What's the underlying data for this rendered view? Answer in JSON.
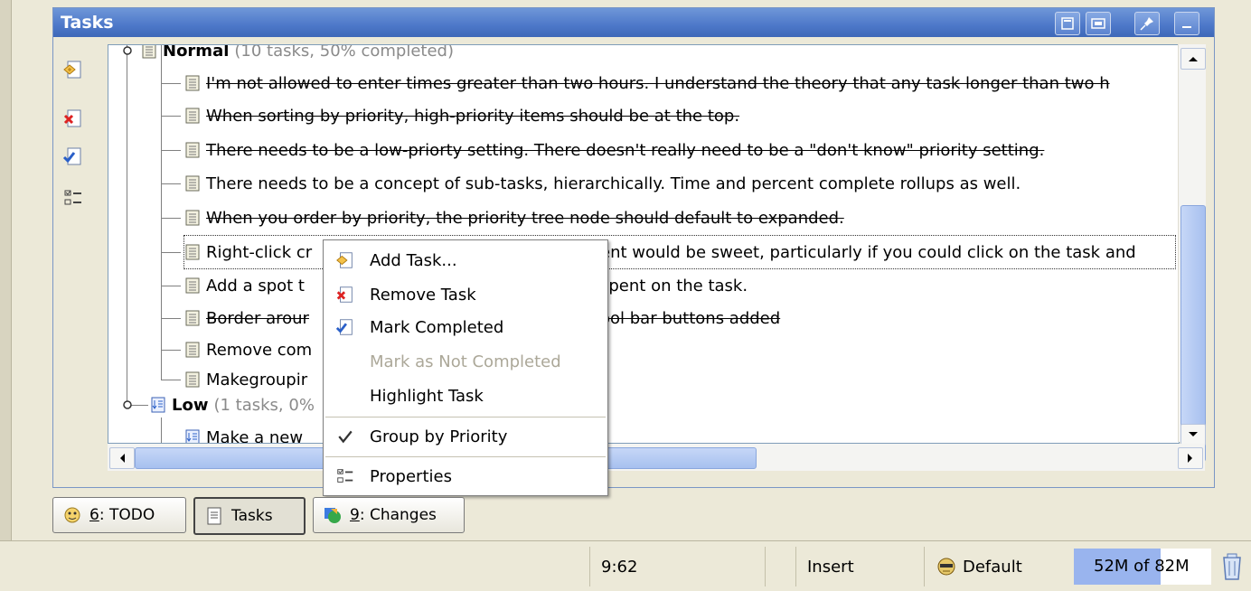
{
  "panel": {
    "title": "Tasks"
  },
  "tree": {
    "groups": [
      {
        "name": "Normal",
        "summary": "(10 tasks, 50% completed)"
      },
      {
        "name": "Low",
        "summary": "(1 tasks, 0%"
      }
    ],
    "tasks": [
      {
        "text": "I'm not allowed to enter times greater than two hours. I understand the theory that any task longer than two h",
        "completed": true
      },
      {
        "text": "When sorting by priority, high-priority items should be at the top.",
        "completed": true
      },
      {
        "text": "There needs to be a low-priorty setting. There doesn't really need to be a \"don't know\" priority setting.",
        "completed": true
      },
      {
        "text": "There needs to be a concept of sub-tasks, hierarchically. Time and percent complete rollups as well.",
        "completed": false
      },
      {
        "text": "When you order by priority, the priority tree node should default to expanded.",
        "completed": true
      },
      {
        "text_left": "Right-click cr",
        "text_right": "ent would be sweet, particularly if you could click on the task and",
        "completed": false,
        "focused": true
      },
      {
        "text_left": "Add a spot t",
        "text_right": "spent on the task.",
        "completed": false
      },
      {
        "text_left": "Border arour",
        "text_right": "ool bar buttons added",
        "completed": true
      },
      {
        "text_left": "Remove com",
        "text_right": "",
        "completed": false
      },
      {
        "text_left": "Makegroupir",
        "text_right": "",
        "completed": false
      }
    ],
    "low_tasks": [
      {
        "text_left": "Make a new",
        "completed": false
      }
    ]
  },
  "context_menu": {
    "items": [
      {
        "label": "Add Task...",
        "icon": "add-task-icon",
        "enabled": true
      },
      {
        "label": "Remove Task",
        "icon": "remove-task-icon",
        "enabled": true
      },
      {
        "label": "Mark Completed",
        "icon": "mark-completed-icon",
        "enabled": true
      },
      {
        "label": "Mark as Not Completed",
        "icon": "",
        "enabled": false
      },
      {
        "label": "Highlight Task",
        "icon": "",
        "enabled": true
      },
      {
        "label": "Group by Priority",
        "icon": "checkmark-icon",
        "enabled": true,
        "checked": true
      },
      {
        "label": "Properties",
        "icon": "properties-icon",
        "enabled": true
      }
    ]
  },
  "bottom_tabs": [
    {
      "mnemonic": "6",
      "label": ": TODO",
      "icon": "todo-icon",
      "active": false
    },
    {
      "mnemonic": "",
      "label": "Tasks",
      "icon": "tasks-icon",
      "active": true
    },
    {
      "mnemonic": "9",
      "label": ": Changes",
      "icon": "changes-icon",
      "active": false
    }
  ],
  "status_bar": {
    "position": "9:62",
    "mode": "Insert",
    "scheme": "Default",
    "memory": "52M of 82M",
    "memory_fraction": 0.634
  },
  "colors": {
    "title_bar": "#4d78c9",
    "memory_fill": "#99b4ee",
    "disabled_text": "#aca899"
  }
}
